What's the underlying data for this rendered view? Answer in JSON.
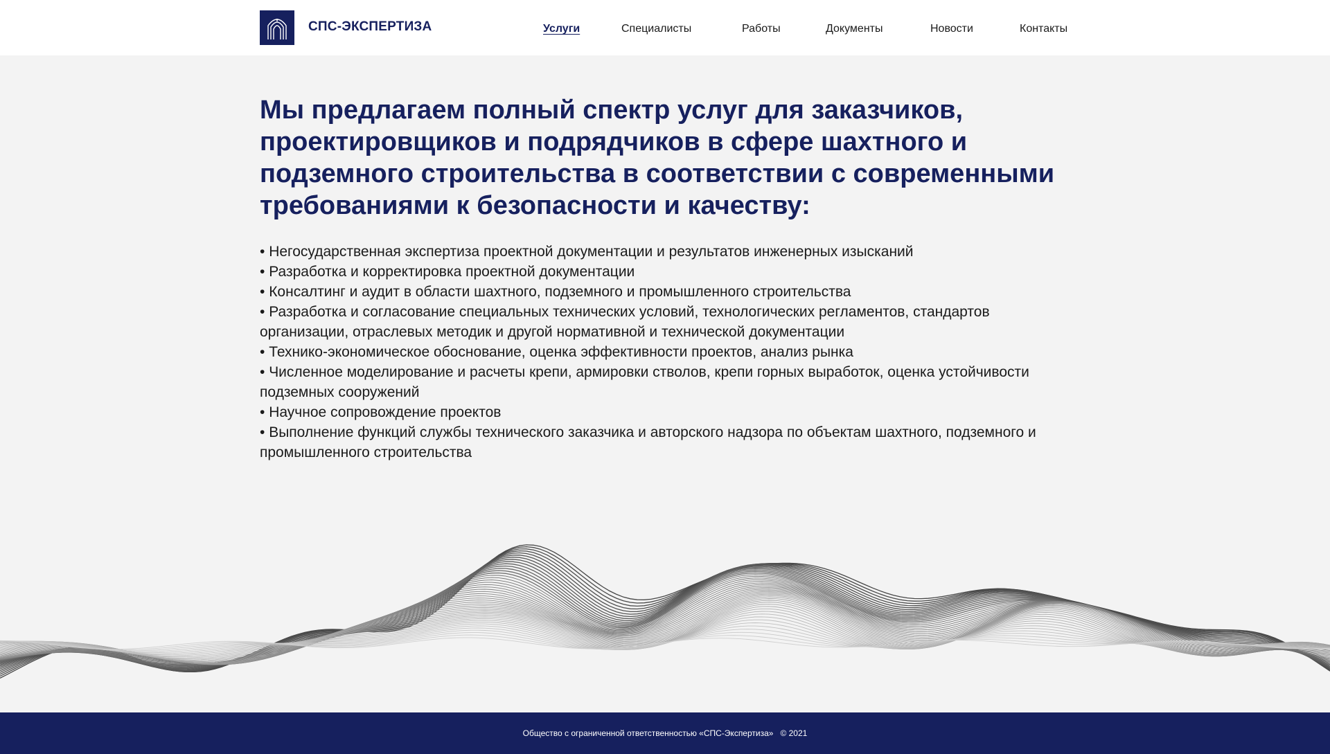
{
  "header": {
    "brand": "СПС-ЭКСПЕРТИЗА",
    "logo_icon": "arch-portal-icon",
    "nav": [
      {
        "label": "Услуги",
        "active": true
      },
      {
        "label": "Специалисты",
        "active": false
      },
      {
        "label": "Работы",
        "active": false
      },
      {
        "label": "Документы",
        "active": false
      },
      {
        "label": "Новости",
        "active": false
      },
      {
        "label": "Контакты",
        "active": false
      }
    ]
  },
  "main": {
    "headline": "Мы предлагаем полный спектр услуг для заказчиков, проектировщиков и подрядчиков в сфере шахтного и подземного строительства в соответствии с современными требованиями к безопасности и качеству:",
    "services": [
      "Негосударственная экспертиза проектной документации и результатов инженерных изысканий",
      "Разработка и корректировка проектной документации",
      "Консалтинг и аудит в области шахтного, подземного и промышленного строительства",
      "Разработка и согласование специальных технических условий, технологических регламентов, стандартов организации, отраслевых методик и другой нормативной и технической документации",
      "Технико-экономическое обоснование, оценка эффективности проектов, анализ рынка",
      "Численное моделирование и расчеты крепи, армировки стволов, крепи горных выработок, оценка устойчивости подземных сооружений",
      "Научное сопровождение проектов",
      "Выполнение функций службы технического заказчика и авторского надзора по объектам шахтного, подземного и промышленного строительства"
    ]
  },
  "footer": {
    "company": "Общество с ограниченной ответственностью «СПС-Экспертиза»",
    "copyright": "© 2021"
  },
  "colors": {
    "brand": "#16205e",
    "background": "#f3f3f3",
    "text": "#1a1a1a",
    "header_bg": "#ffffff"
  }
}
